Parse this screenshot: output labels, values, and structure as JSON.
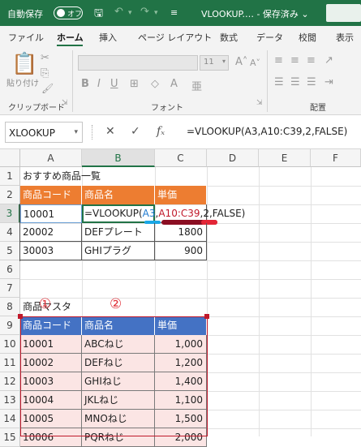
{
  "titlebar": {
    "autosave_label": "自動保存",
    "toggle_label": "オフ",
    "window_title": "VLOOKUP.… - 保存済み ⌄"
  },
  "tabs": [
    "ファイル",
    "ホーム",
    "挿入",
    "ページ レイアウト",
    "数式",
    "データ",
    "校閲",
    "表示"
  ],
  "active_tab": "ホーム",
  "ribbon": {
    "paste_label": "貼り付け",
    "clipboard_group": "クリップボード",
    "font_group": "フォント",
    "align_group": "配置",
    "font_size": "11"
  },
  "formula_bar": {
    "name_box": "XLOOKUP",
    "formula": "=VLOOKUP(A3,A10:C39,2,FALSE)"
  },
  "columns": [
    "A",
    "B",
    "C",
    "D",
    "E",
    "F"
  ],
  "rows": [
    "1",
    "2",
    "3",
    "4",
    "5",
    "6",
    "7",
    "8",
    "9",
    "10",
    "11",
    "12",
    "13",
    "14",
    "15"
  ],
  "sheet": {
    "r1_title": "おすすめ商品一覧",
    "t1_headers": [
      "商品コード",
      "商品名",
      "単価"
    ],
    "t1_rows": [
      [
        "10001",
        "",
        ""
      ],
      [
        "20002",
        "DEFプレート",
        "1800"
      ],
      [
        "30003",
        "GHIプラグ",
        "900"
      ]
    ],
    "edit_formula": {
      "p1": "=VLOOKUP(",
      "ref1": "A3",
      "comma1": ",",
      "ref2": "A10:C39",
      "rest": ",2,FALSE)"
    },
    "r8_title": "商品マスタ",
    "t2_headers": [
      "商品コード",
      "商品名",
      "単価"
    ],
    "t2_rows": [
      [
        "10001",
        "ABCねじ",
        "1,000"
      ],
      [
        "10002",
        "DEFねじ",
        "1,200"
      ],
      [
        "10003",
        "GHIねじ",
        "1,400"
      ],
      [
        "10004",
        "JKLねじ",
        "1,100"
      ],
      [
        "10005",
        "MNOねじ",
        "1,500"
      ],
      [
        "10006",
        "PQRねじ",
        "2,000"
      ]
    ],
    "markers": [
      "①",
      "②"
    ]
  },
  "colors": {
    "excel_green": "#217346",
    "orange_header": "#ed7d31",
    "blue_header": "#4472c4",
    "pink_fill": "#fbe5e4",
    "ref_blue": "#1f7ad0",
    "ref_red": "#c0182a"
  }
}
